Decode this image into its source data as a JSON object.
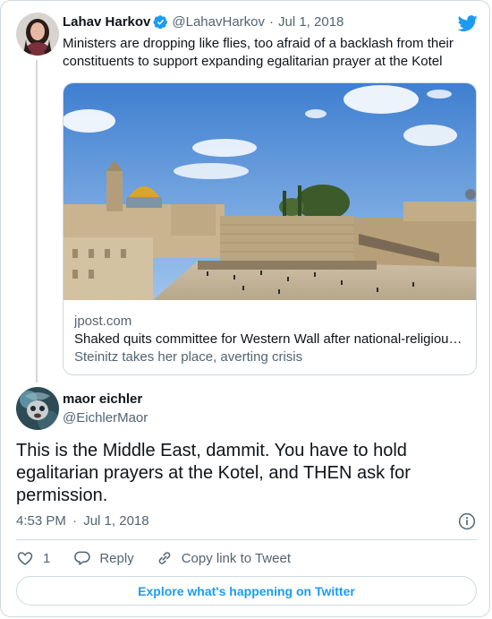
{
  "colors": {
    "brand_blue": "#1d9bf0",
    "text": "#0f1419",
    "muted": "#536471",
    "border": "#cfd9de"
  },
  "quoted_tweet": {
    "author_name": "Lahav Harkov",
    "handle": "@LahavHarkov",
    "separator": "·",
    "date": "Jul 1, 2018",
    "text": "Ministers are dropping like flies, too afraid of a backlash from their constituents to support expanding egalitarian prayer at the Kotel",
    "link_card": {
      "domain": "jpost.com",
      "title": "Shaked quits committee for Western Wall after national-religious…",
      "description": "Steinitz takes her place, averting crisis"
    }
  },
  "tweet": {
    "author_name": "maor eichler",
    "handle": "@EichlerMaor",
    "text": "This is the Middle East, dammit. You have to hold egalitarian prayers at the Kotel, and THEN ask for permission.",
    "time": "4:53 PM",
    "separator": "·",
    "date": "Jul 1, 2018"
  },
  "actions": {
    "like_count": "1",
    "reply_label": "Reply",
    "copy_link_label": "Copy link to Tweet"
  },
  "footer": {
    "explore_label": "Explore what's happening on Twitter"
  },
  "icons": [
    "twitter-bird-icon",
    "verified-icon",
    "info-icon",
    "heart-icon",
    "reply-icon",
    "link-icon"
  ]
}
